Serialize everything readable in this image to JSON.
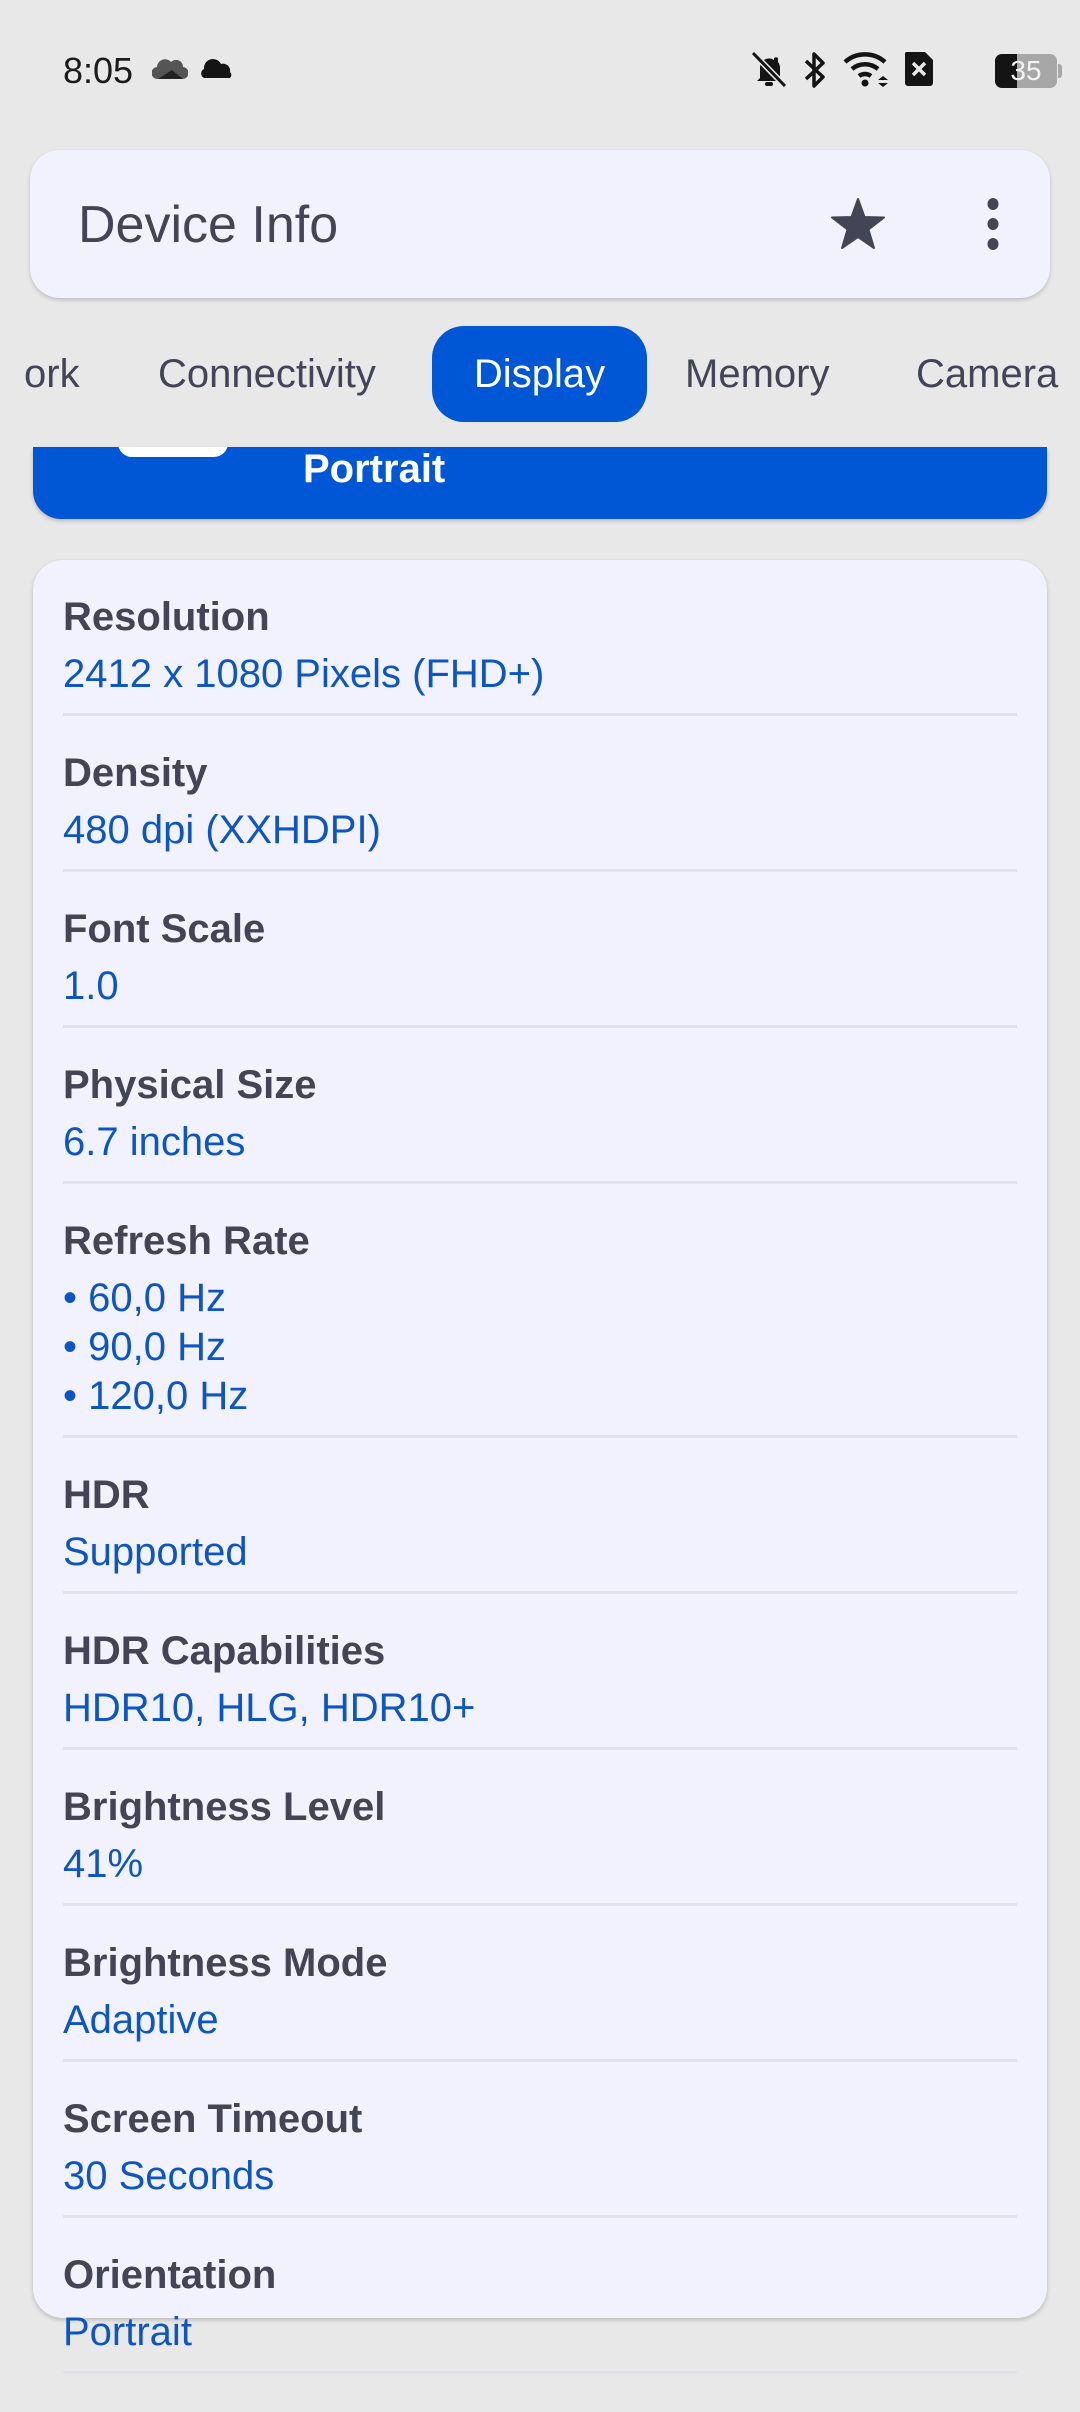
{
  "status_bar": {
    "time": "8:05",
    "left_icons": [
      "onedrive-cloud-icon",
      "cloud-icon"
    ],
    "right_icons": [
      "notifications-off-icon",
      "bluetooth-icon",
      "wifi-icon",
      "no-sim-icon",
      "battery-icon"
    ],
    "battery_percent": 35,
    "battery_label": "35"
  },
  "app_bar": {
    "title": "Device Info",
    "actions": [
      "star-icon",
      "more-vert-icon"
    ]
  },
  "tabs": [
    {
      "label": "ork",
      "active": false
    },
    {
      "label": "Connectivity",
      "active": false
    },
    {
      "label": "Display",
      "active": true
    },
    {
      "label": "Memory",
      "active": false
    },
    {
      "label": "Camera",
      "active": false
    }
  ],
  "hero": {
    "value": "Portrait"
  },
  "colors": {
    "accent": "#0057d5",
    "value_text": "#0d56c2",
    "label_text": "#434556",
    "card_bg": "#f1f2fd",
    "page_bg": "#e8e8e8"
  },
  "display_info": [
    {
      "label": "Resolution",
      "value": "2412 x 1080 Pixels (FHD+)"
    },
    {
      "label": "Density",
      "value": "480 dpi (XXHDPI)"
    },
    {
      "label": "Font Scale",
      "value": "1.0"
    },
    {
      "label": "Physical Size",
      "value": "6.7 inches"
    },
    {
      "label": "Refresh Rate",
      "values": [
        "• 60,0 Hz",
        "• 90,0 Hz",
        "• 120,0 Hz"
      ]
    },
    {
      "label": "HDR",
      "value": "Supported"
    },
    {
      "label": "HDR Capabilities",
      "value": "HDR10, HLG, HDR10+"
    },
    {
      "label": "Brightness Level",
      "value": "41%"
    },
    {
      "label": "Brightness Mode",
      "value": "Adaptive"
    },
    {
      "label": "Screen Timeout",
      "value": "30 Seconds"
    },
    {
      "label": "Orientation",
      "value": "Portrait"
    }
  ]
}
